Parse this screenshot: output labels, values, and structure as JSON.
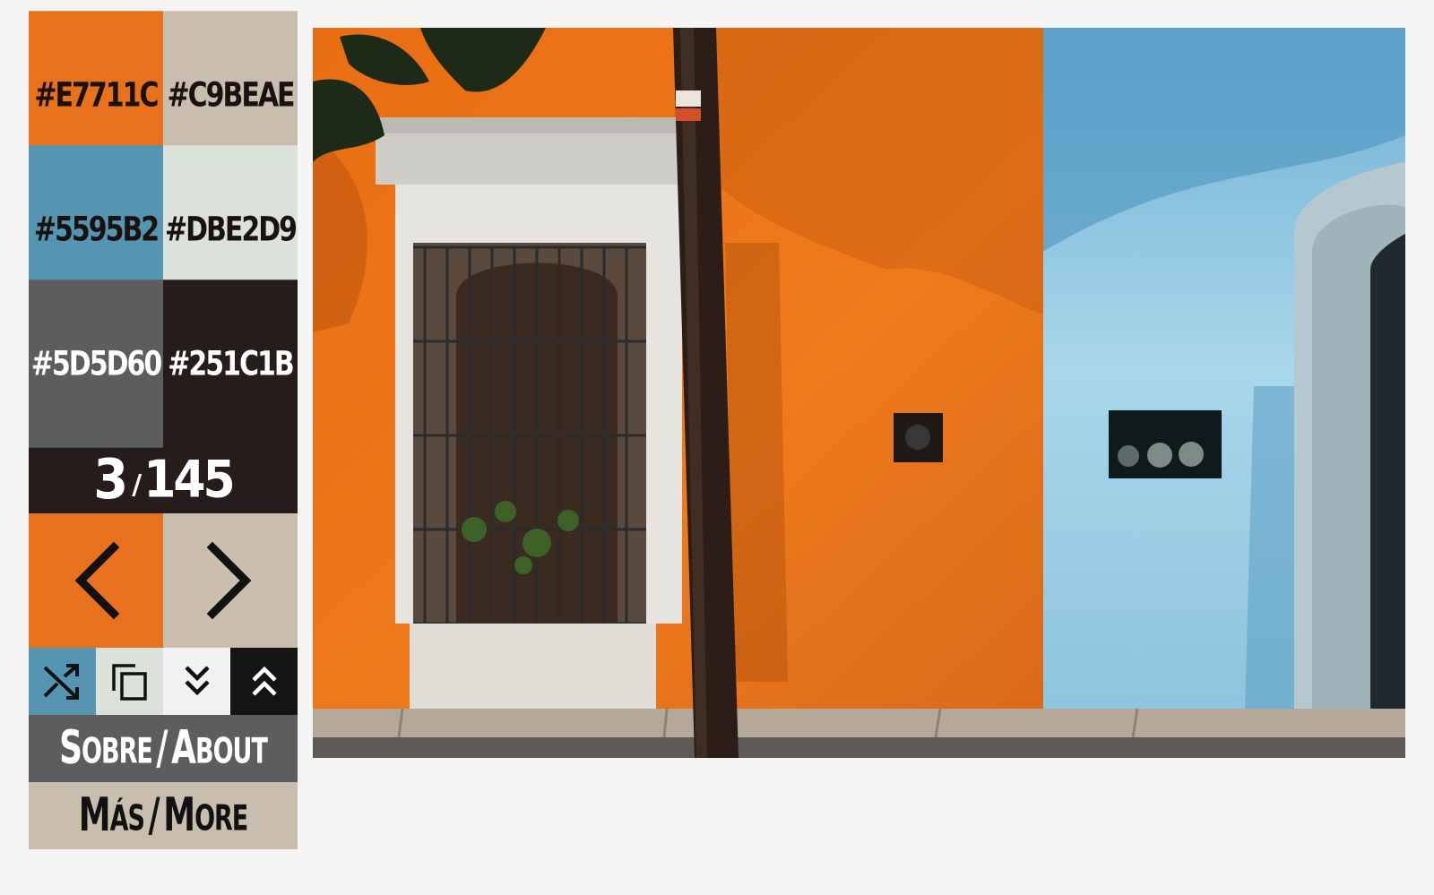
{
  "palette": [
    {
      "hex": "#E7711C",
      "bg": "#E7711C",
      "fg": "#1b1110"
    },
    {
      "hex": "#C9BEAE",
      "bg": "#C9BEAE",
      "fg": "#1b1110"
    },
    {
      "hex": "#5595B2",
      "bg": "#5595B2",
      "fg": "#1b1110"
    },
    {
      "hex": "#DBE2D9",
      "bg": "#DBE2D9",
      "fg": "#1b1110"
    },
    {
      "hex": "#5D5D60",
      "bg": "#5D5D60",
      "fg": "#ffffff"
    },
    {
      "hex": "#251C1B",
      "bg": "#251C1B",
      "fg": "#ffffff"
    }
  ],
  "counter": {
    "current": "3",
    "separator": "/",
    "total": "145"
  },
  "nav": {
    "prev_icon": "chevron-left-icon",
    "next_icon": "chevron-right-icon"
  },
  "tools": [
    {
      "icon": "shuffle-icon",
      "bg": "#5595B2"
    },
    {
      "icon": "copy-icon",
      "bg": "#DBE2D9"
    },
    {
      "icon": "double-chevron-down-icon",
      "bg": "#f2f2f2"
    },
    {
      "icon": "double-chevron-up-icon",
      "bg": "#151515"
    }
  ],
  "menu": {
    "about": {
      "sobre": "Sobre",
      "slash": "/",
      "about": "About"
    },
    "more": {
      "mas": "Más",
      "slash": "/",
      "more": "More"
    }
  },
  "photo": {
    "subject": "street-facade-photo"
  }
}
